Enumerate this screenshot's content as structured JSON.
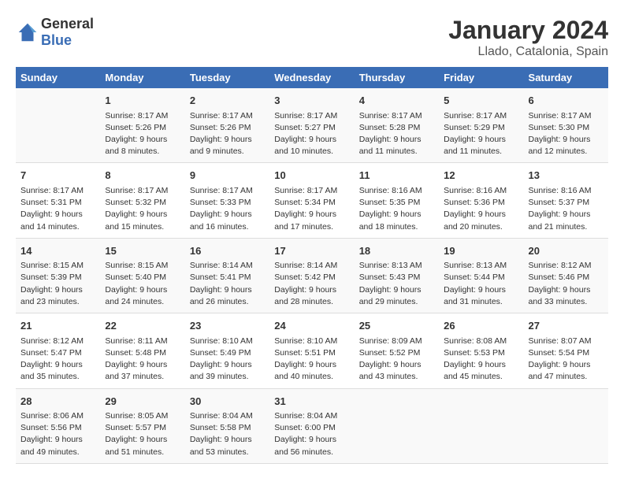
{
  "header": {
    "logo_general": "General",
    "logo_blue": "Blue",
    "title": "January 2024",
    "subtitle": "Llado, Catalonia, Spain"
  },
  "columns": [
    "Sunday",
    "Monday",
    "Tuesday",
    "Wednesday",
    "Thursday",
    "Friday",
    "Saturday"
  ],
  "weeks": [
    [
      {
        "day": "",
        "info": ""
      },
      {
        "day": "1",
        "info": "Sunrise: 8:17 AM\nSunset: 5:26 PM\nDaylight: 9 hours\nand 8 minutes."
      },
      {
        "day": "2",
        "info": "Sunrise: 8:17 AM\nSunset: 5:26 PM\nDaylight: 9 hours\nand 9 minutes."
      },
      {
        "day": "3",
        "info": "Sunrise: 8:17 AM\nSunset: 5:27 PM\nDaylight: 9 hours\nand 10 minutes."
      },
      {
        "day": "4",
        "info": "Sunrise: 8:17 AM\nSunset: 5:28 PM\nDaylight: 9 hours\nand 11 minutes."
      },
      {
        "day": "5",
        "info": "Sunrise: 8:17 AM\nSunset: 5:29 PM\nDaylight: 9 hours\nand 11 minutes."
      },
      {
        "day": "6",
        "info": "Sunrise: 8:17 AM\nSunset: 5:30 PM\nDaylight: 9 hours\nand 12 minutes."
      }
    ],
    [
      {
        "day": "7",
        "info": "Sunrise: 8:17 AM\nSunset: 5:31 PM\nDaylight: 9 hours\nand 14 minutes."
      },
      {
        "day": "8",
        "info": "Sunrise: 8:17 AM\nSunset: 5:32 PM\nDaylight: 9 hours\nand 15 minutes."
      },
      {
        "day": "9",
        "info": "Sunrise: 8:17 AM\nSunset: 5:33 PM\nDaylight: 9 hours\nand 16 minutes."
      },
      {
        "day": "10",
        "info": "Sunrise: 8:17 AM\nSunset: 5:34 PM\nDaylight: 9 hours\nand 17 minutes."
      },
      {
        "day": "11",
        "info": "Sunrise: 8:16 AM\nSunset: 5:35 PM\nDaylight: 9 hours\nand 18 minutes."
      },
      {
        "day": "12",
        "info": "Sunrise: 8:16 AM\nSunset: 5:36 PM\nDaylight: 9 hours\nand 20 minutes."
      },
      {
        "day": "13",
        "info": "Sunrise: 8:16 AM\nSunset: 5:37 PM\nDaylight: 9 hours\nand 21 minutes."
      }
    ],
    [
      {
        "day": "14",
        "info": "Sunrise: 8:15 AM\nSunset: 5:39 PM\nDaylight: 9 hours\nand 23 minutes."
      },
      {
        "day": "15",
        "info": "Sunrise: 8:15 AM\nSunset: 5:40 PM\nDaylight: 9 hours\nand 24 minutes."
      },
      {
        "day": "16",
        "info": "Sunrise: 8:14 AM\nSunset: 5:41 PM\nDaylight: 9 hours\nand 26 minutes."
      },
      {
        "day": "17",
        "info": "Sunrise: 8:14 AM\nSunset: 5:42 PM\nDaylight: 9 hours\nand 28 minutes."
      },
      {
        "day": "18",
        "info": "Sunrise: 8:13 AM\nSunset: 5:43 PM\nDaylight: 9 hours\nand 29 minutes."
      },
      {
        "day": "19",
        "info": "Sunrise: 8:13 AM\nSunset: 5:44 PM\nDaylight: 9 hours\nand 31 minutes."
      },
      {
        "day": "20",
        "info": "Sunrise: 8:12 AM\nSunset: 5:46 PM\nDaylight: 9 hours\nand 33 minutes."
      }
    ],
    [
      {
        "day": "21",
        "info": "Sunrise: 8:12 AM\nSunset: 5:47 PM\nDaylight: 9 hours\nand 35 minutes."
      },
      {
        "day": "22",
        "info": "Sunrise: 8:11 AM\nSunset: 5:48 PM\nDaylight: 9 hours\nand 37 minutes."
      },
      {
        "day": "23",
        "info": "Sunrise: 8:10 AM\nSunset: 5:49 PM\nDaylight: 9 hours\nand 39 minutes."
      },
      {
        "day": "24",
        "info": "Sunrise: 8:10 AM\nSunset: 5:51 PM\nDaylight: 9 hours\nand 40 minutes."
      },
      {
        "day": "25",
        "info": "Sunrise: 8:09 AM\nSunset: 5:52 PM\nDaylight: 9 hours\nand 43 minutes."
      },
      {
        "day": "26",
        "info": "Sunrise: 8:08 AM\nSunset: 5:53 PM\nDaylight: 9 hours\nand 45 minutes."
      },
      {
        "day": "27",
        "info": "Sunrise: 8:07 AM\nSunset: 5:54 PM\nDaylight: 9 hours\nand 47 minutes."
      }
    ],
    [
      {
        "day": "28",
        "info": "Sunrise: 8:06 AM\nSunset: 5:56 PM\nDaylight: 9 hours\nand 49 minutes."
      },
      {
        "day": "29",
        "info": "Sunrise: 8:05 AM\nSunset: 5:57 PM\nDaylight: 9 hours\nand 51 minutes."
      },
      {
        "day": "30",
        "info": "Sunrise: 8:04 AM\nSunset: 5:58 PM\nDaylight: 9 hours\nand 53 minutes."
      },
      {
        "day": "31",
        "info": "Sunrise: 8:04 AM\nSunset: 6:00 PM\nDaylight: 9 hours\nand 56 minutes."
      },
      {
        "day": "",
        "info": ""
      },
      {
        "day": "",
        "info": ""
      },
      {
        "day": "",
        "info": ""
      }
    ]
  ]
}
